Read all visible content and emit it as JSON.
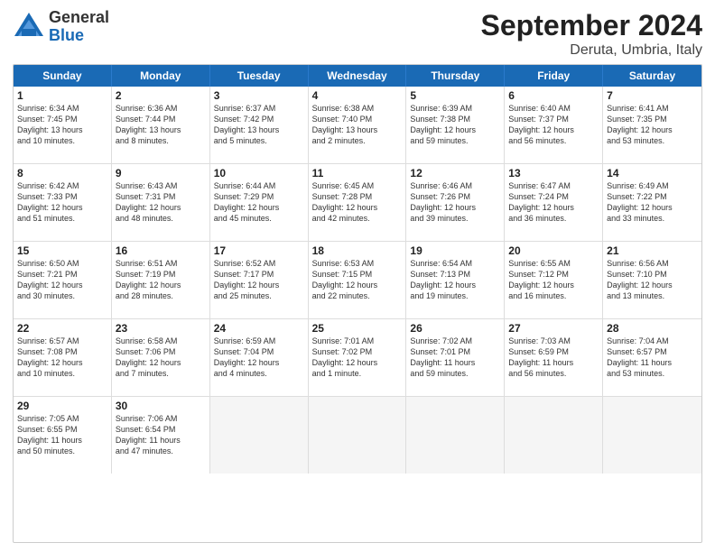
{
  "header": {
    "logo_general": "General",
    "logo_blue": "Blue",
    "title": "September 2024",
    "subtitle": "Deruta, Umbria, Italy"
  },
  "calendar": {
    "weekdays": [
      "Sunday",
      "Monday",
      "Tuesday",
      "Wednesday",
      "Thursday",
      "Friday",
      "Saturday"
    ],
    "rows": [
      [
        {
          "day": "1",
          "lines": [
            "Sunrise: 6:34 AM",
            "Sunset: 7:45 PM",
            "Daylight: 13 hours",
            "and 10 minutes."
          ]
        },
        {
          "day": "2",
          "lines": [
            "Sunrise: 6:36 AM",
            "Sunset: 7:44 PM",
            "Daylight: 13 hours",
            "and 8 minutes."
          ]
        },
        {
          "day": "3",
          "lines": [
            "Sunrise: 6:37 AM",
            "Sunset: 7:42 PM",
            "Daylight: 13 hours",
            "and 5 minutes."
          ]
        },
        {
          "day": "4",
          "lines": [
            "Sunrise: 6:38 AM",
            "Sunset: 7:40 PM",
            "Daylight: 13 hours",
            "and 2 minutes."
          ]
        },
        {
          "day": "5",
          "lines": [
            "Sunrise: 6:39 AM",
            "Sunset: 7:38 PM",
            "Daylight: 12 hours",
            "and 59 minutes."
          ]
        },
        {
          "day": "6",
          "lines": [
            "Sunrise: 6:40 AM",
            "Sunset: 7:37 PM",
            "Daylight: 12 hours",
            "and 56 minutes."
          ]
        },
        {
          "day": "7",
          "lines": [
            "Sunrise: 6:41 AM",
            "Sunset: 7:35 PM",
            "Daylight: 12 hours",
            "and 53 minutes."
          ]
        }
      ],
      [
        {
          "day": "8",
          "lines": [
            "Sunrise: 6:42 AM",
            "Sunset: 7:33 PM",
            "Daylight: 12 hours",
            "and 51 minutes."
          ]
        },
        {
          "day": "9",
          "lines": [
            "Sunrise: 6:43 AM",
            "Sunset: 7:31 PM",
            "Daylight: 12 hours",
            "and 48 minutes."
          ]
        },
        {
          "day": "10",
          "lines": [
            "Sunrise: 6:44 AM",
            "Sunset: 7:29 PM",
            "Daylight: 12 hours",
            "and 45 minutes."
          ]
        },
        {
          "day": "11",
          "lines": [
            "Sunrise: 6:45 AM",
            "Sunset: 7:28 PM",
            "Daylight: 12 hours",
            "and 42 minutes."
          ]
        },
        {
          "day": "12",
          "lines": [
            "Sunrise: 6:46 AM",
            "Sunset: 7:26 PM",
            "Daylight: 12 hours",
            "and 39 minutes."
          ]
        },
        {
          "day": "13",
          "lines": [
            "Sunrise: 6:47 AM",
            "Sunset: 7:24 PM",
            "Daylight: 12 hours",
            "and 36 minutes."
          ]
        },
        {
          "day": "14",
          "lines": [
            "Sunrise: 6:49 AM",
            "Sunset: 7:22 PM",
            "Daylight: 12 hours",
            "and 33 minutes."
          ]
        }
      ],
      [
        {
          "day": "15",
          "lines": [
            "Sunrise: 6:50 AM",
            "Sunset: 7:21 PM",
            "Daylight: 12 hours",
            "and 30 minutes."
          ]
        },
        {
          "day": "16",
          "lines": [
            "Sunrise: 6:51 AM",
            "Sunset: 7:19 PM",
            "Daylight: 12 hours",
            "and 28 minutes."
          ]
        },
        {
          "day": "17",
          "lines": [
            "Sunrise: 6:52 AM",
            "Sunset: 7:17 PM",
            "Daylight: 12 hours",
            "and 25 minutes."
          ]
        },
        {
          "day": "18",
          "lines": [
            "Sunrise: 6:53 AM",
            "Sunset: 7:15 PM",
            "Daylight: 12 hours",
            "and 22 minutes."
          ]
        },
        {
          "day": "19",
          "lines": [
            "Sunrise: 6:54 AM",
            "Sunset: 7:13 PM",
            "Daylight: 12 hours",
            "and 19 minutes."
          ]
        },
        {
          "day": "20",
          "lines": [
            "Sunrise: 6:55 AM",
            "Sunset: 7:12 PM",
            "Daylight: 12 hours",
            "and 16 minutes."
          ]
        },
        {
          "day": "21",
          "lines": [
            "Sunrise: 6:56 AM",
            "Sunset: 7:10 PM",
            "Daylight: 12 hours",
            "and 13 minutes."
          ]
        }
      ],
      [
        {
          "day": "22",
          "lines": [
            "Sunrise: 6:57 AM",
            "Sunset: 7:08 PM",
            "Daylight: 12 hours",
            "and 10 minutes."
          ]
        },
        {
          "day": "23",
          "lines": [
            "Sunrise: 6:58 AM",
            "Sunset: 7:06 PM",
            "Daylight: 12 hours",
            "and 7 minutes."
          ]
        },
        {
          "day": "24",
          "lines": [
            "Sunrise: 6:59 AM",
            "Sunset: 7:04 PM",
            "Daylight: 12 hours",
            "and 4 minutes."
          ]
        },
        {
          "day": "25",
          "lines": [
            "Sunrise: 7:01 AM",
            "Sunset: 7:02 PM",
            "Daylight: 12 hours",
            "and 1 minute."
          ]
        },
        {
          "day": "26",
          "lines": [
            "Sunrise: 7:02 AM",
            "Sunset: 7:01 PM",
            "Daylight: 11 hours",
            "and 59 minutes."
          ]
        },
        {
          "day": "27",
          "lines": [
            "Sunrise: 7:03 AM",
            "Sunset: 6:59 PM",
            "Daylight: 11 hours",
            "and 56 minutes."
          ]
        },
        {
          "day": "28",
          "lines": [
            "Sunrise: 7:04 AM",
            "Sunset: 6:57 PM",
            "Daylight: 11 hours",
            "and 53 minutes."
          ]
        }
      ],
      [
        {
          "day": "29",
          "lines": [
            "Sunrise: 7:05 AM",
            "Sunset: 6:55 PM",
            "Daylight: 11 hours",
            "and 50 minutes."
          ]
        },
        {
          "day": "30",
          "lines": [
            "Sunrise: 7:06 AM",
            "Sunset: 6:54 PM",
            "Daylight: 11 hours",
            "and 47 minutes."
          ]
        },
        {
          "day": "",
          "lines": []
        },
        {
          "day": "",
          "lines": []
        },
        {
          "day": "",
          "lines": []
        },
        {
          "day": "",
          "lines": []
        },
        {
          "day": "",
          "lines": []
        }
      ]
    ]
  }
}
